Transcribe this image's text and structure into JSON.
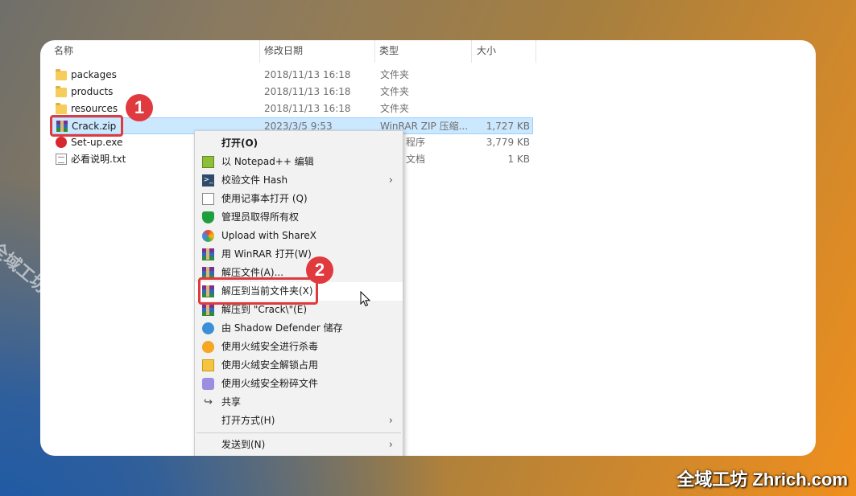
{
  "columns": {
    "name": "名称",
    "modified": "修改日期",
    "type": "类型",
    "size": "大小"
  },
  "files": [
    {
      "name": "packages",
      "modified": "2018/11/13 16:18",
      "type": "文件夹",
      "size": "",
      "icon": "folder-icon"
    },
    {
      "name": "products",
      "modified": "2018/11/13 16:18",
      "type": "文件夹",
      "size": "",
      "icon": "folder-icon"
    },
    {
      "name": "resources",
      "modified": "2018/11/13 16:18",
      "type": "文件夹",
      "size": "",
      "icon": "folder-icon"
    },
    {
      "name": "Crack.zip",
      "modified": "2023/3/5 9:53",
      "type": "WinRAR ZIP 压缩...",
      "size": "1,727 KB",
      "icon": "winrar-icon",
      "selected": true
    },
    {
      "name": "Set-up.exe",
      "modified": "",
      "type": "程序",
      "size": "3,779 KB",
      "icon": "exe-icon"
    },
    {
      "name": "必看说明.txt",
      "modified": "",
      "type": "文档",
      "size": "1 KB",
      "icon": "txt-icon"
    }
  ],
  "context_menu": [
    {
      "label": "打开(O)",
      "icon": "",
      "bold": true
    },
    {
      "label": "以 Notepad++ 编辑",
      "icon": "notepad-plus-plus-icon"
    },
    {
      "label": "校验文件 Hash",
      "icon": "hash-icon",
      "submenu": true
    },
    {
      "label": "使用记事本打开 (Q)",
      "icon": "notepad-icon"
    },
    {
      "label": "管理员取得所有权",
      "icon": "shield-icon"
    },
    {
      "label": "Upload with ShareX",
      "icon": "sharex-icon"
    },
    {
      "label": "用 WinRAR 打开(W)",
      "icon": "winrar-icon"
    },
    {
      "label": "解压文件(A)...",
      "icon": "winrar-icon"
    },
    {
      "label": "解压到当前文件夹(X)",
      "icon": "winrar-icon",
      "hover": true
    },
    {
      "label": "解压到 \"Crack\\\"(E)",
      "icon": "winrar-icon"
    },
    {
      "label": "由 Shadow Defender 储存",
      "icon": "shadow-defender-icon"
    },
    {
      "label": "使用火绒安全进行杀毒",
      "icon": "huorong-icon"
    },
    {
      "label": "使用火绒安全解锁占用",
      "icon": "unlock-icon"
    },
    {
      "label": "使用火绒安全粉碎文件",
      "icon": "shred-icon"
    },
    {
      "label": "共享",
      "icon": "share-icon"
    },
    {
      "label": "打开方式(H)",
      "icon": "",
      "submenu": true
    },
    {
      "label": "发送到(N)",
      "icon": "",
      "submenu": true
    }
  ],
  "annotations": {
    "step1": "1",
    "step2": "2"
  },
  "watermark": {
    "diagonal": "全域工坊 zhrich.com",
    "corner": "全域工坊 Zhrich.com"
  },
  "colors": {
    "accent_red": "#e0393e",
    "selection": "#cce8ff",
    "menu_bg": "#f2f2f2"
  }
}
